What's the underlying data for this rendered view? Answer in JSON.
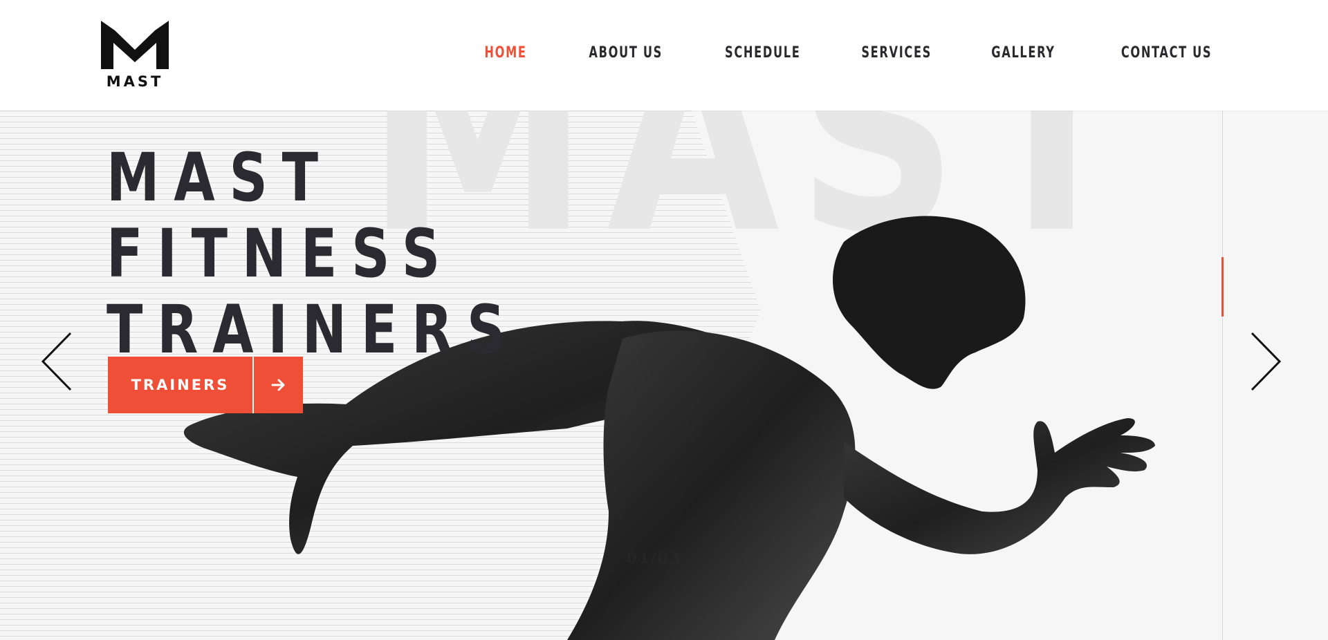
{
  "header": {
    "logo_text": "MAST",
    "nav": [
      {
        "label": "HOME",
        "active": true
      },
      {
        "label": "ABOUT US",
        "active": false
      },
      {
        "label": "SCHEDULE",
        "active": false
      },
      {
        "label": "SERVICES",
        "active": false
      },
      {
        "label": "GALLERY",
        "active": false
      },
      {
        "label": "CONTACT US",
        "active": false
      }
    ]
  },
  "hero": {
    "background_word": "MAST",
    "title_lines": [
      "MAST",
      "FITNESS",
      "TRAINERS"
    ],
    "cta_label": "TRAINERS",
    "cta_icon": "arrow-right-icon",
    "prev_icon": "chevron-left-icon",
    "next_icon": "chevron-right-icon",
    "slide_counter": "01/03"
  },
  "colors": {
    "accent": "#ee4f36",
    "text_dark": "#2b2a30",
    "background": "#f6f6f6"
  }
}
